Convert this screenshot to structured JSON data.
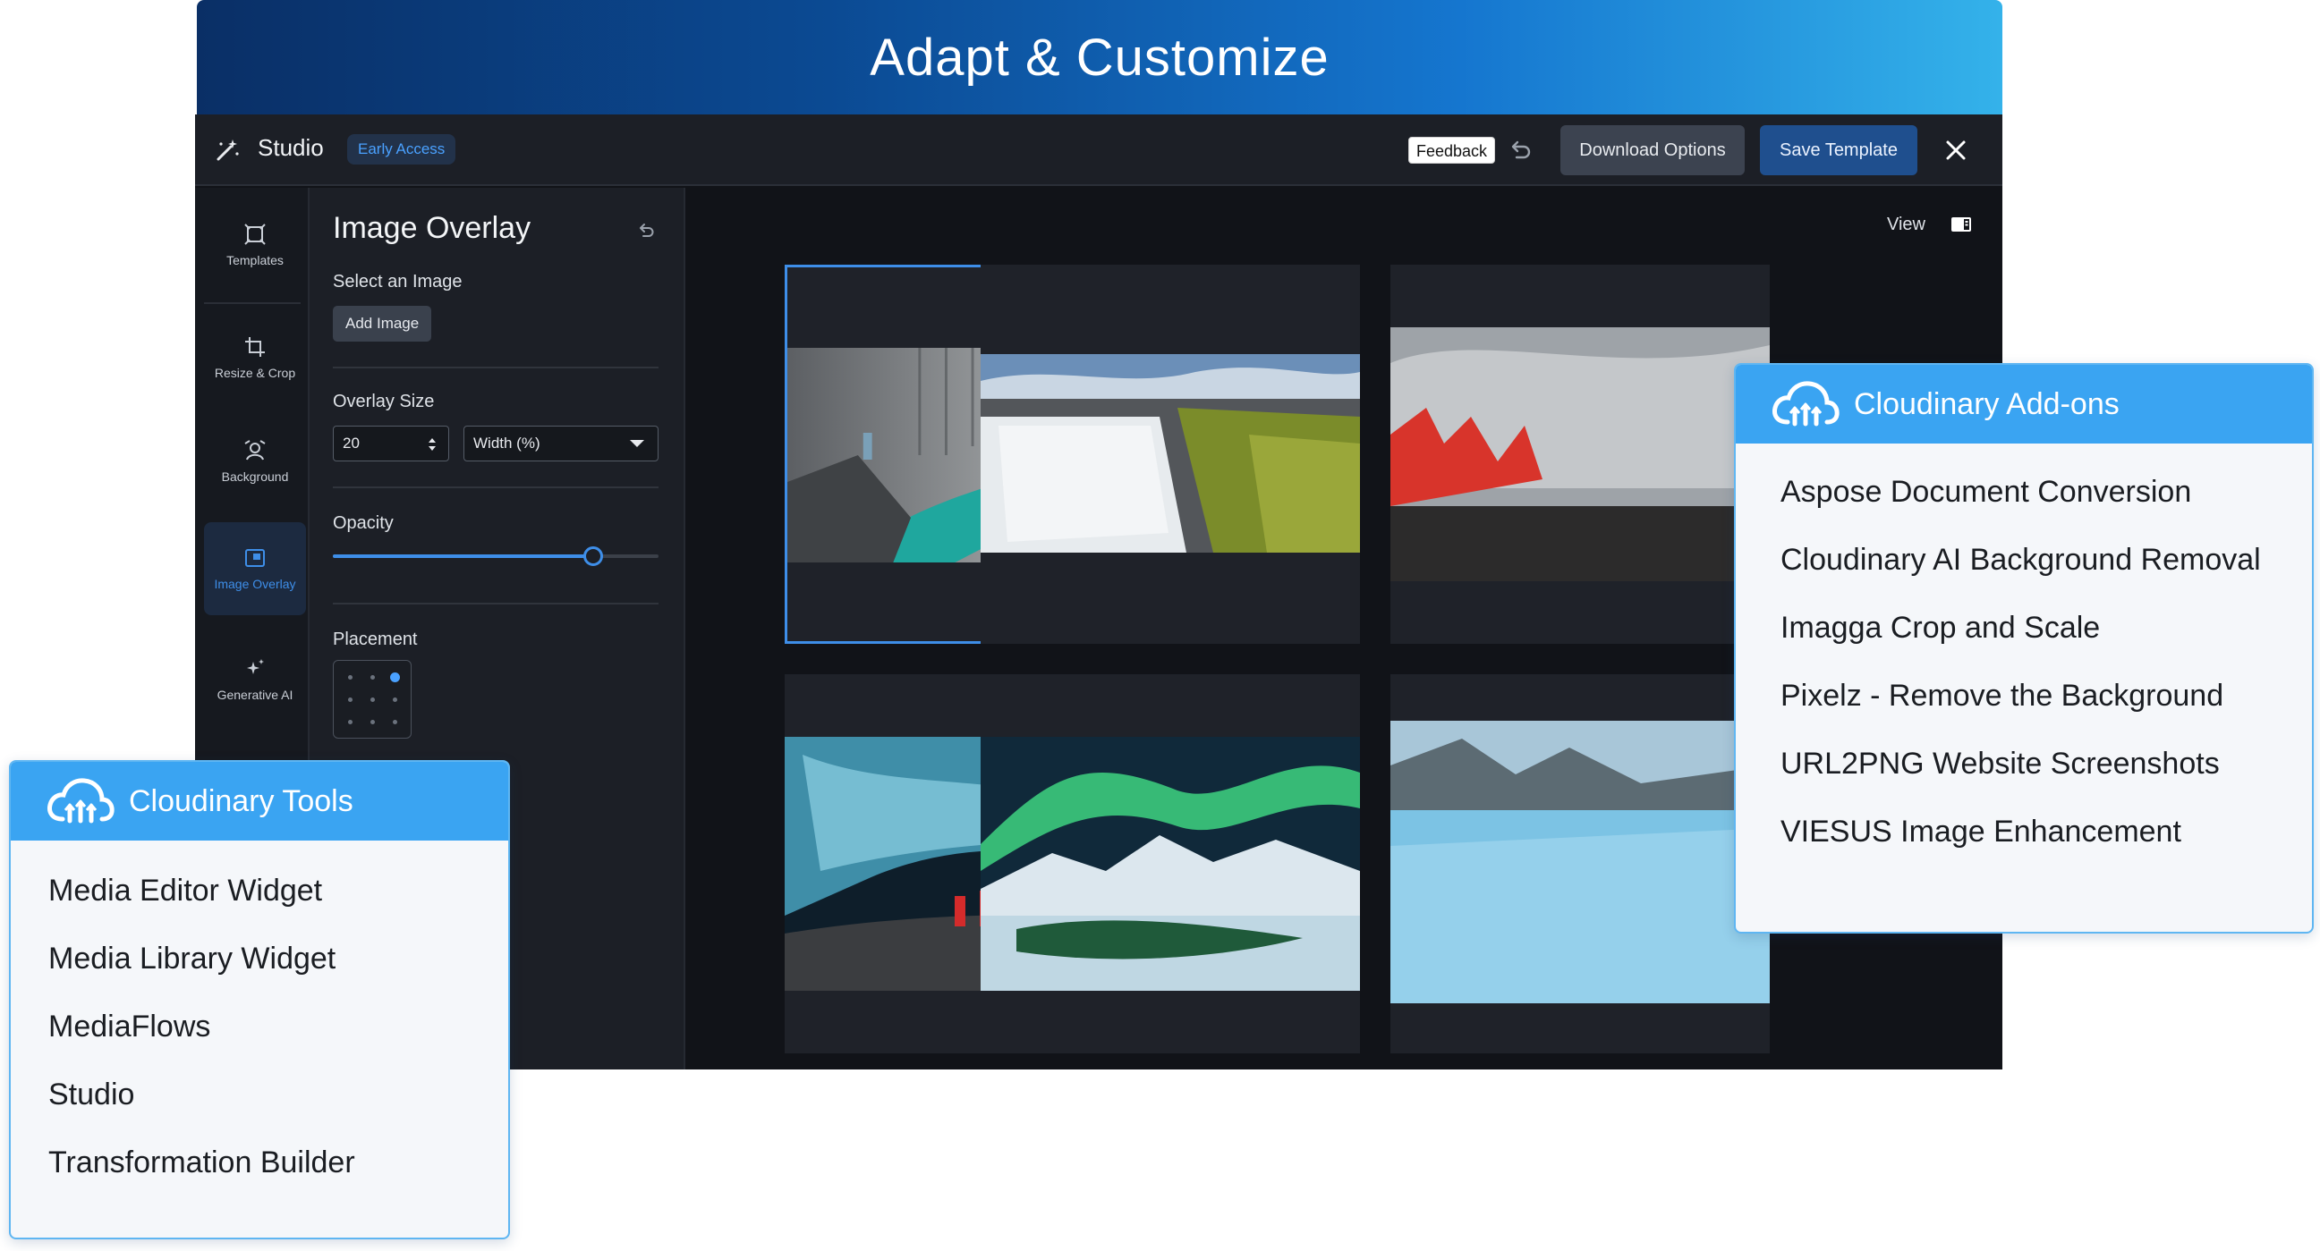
{
  "banner": {
    "title": "Adapt & Customize"
  },
  "topbar": {
    "logo_icon": "magic-wand-icon",
    "title": "Studio",
    "badge": "Early Access",
    "feedback": "Feedback",
    "download_label": "Download Options",
    "save_label": "Save Template",
    "close_icon": "close-icon"
  },
  "rail": {
    "items": [
      {
        "label": "Templates",
        "icon": "templates-icon"
      },
      {
        "label": "Resize & Crop",
        "icon": "crop-icon"
      },
      {
        "label": "Background",
        "icon": "background-icon"
      },
      {
        "label": "Image Overlay",
        "icon": "image-overlay-icon",
        "active": true
      },
      {
        "label": "Generative AI",
        "icon": "sparkle-icon"
      }
    ]
  },
  "panel": {
    "title": "Image Overlay",
    "select_label": "Select an Image",
    "add_image": "Add Image",
    "overlay_size_label": "Overlay Size",
    "overlay_size_value": "20",
    "overlay_unit": "Width (%)",
    "opacity_label": "Opacity",
    "opacity_value": 0.8,
    "placement_label": "Placement",
    "placement_selected": "top-right"
  },
  "canvas": {
    "view_label": "View",
    "images": [
      {
        "name": "basalt-canyon",
        "selected": true
      },
      {
        "name": "waterfall"
      },
      {
        "name": "volcano-eruption"
      },
      {
        "name": "ice-cave"
      },
      {
        "name": "northern-lights"
      },
      {
        "name": "glacier"
      }
    ]
  },
  "tools_card": {
    "title": "Cloudinary Tools",
    "items": [
      "Media Editor Widget",
      "Media Library Widget",
      "MediaFlows",
      "Studio",
      "Transformation Builder"
    ]
  },
  "addons_card": {
    "title": "Cloudinary Add-ons",
    "items": [
      "Aspose Document Conversion",
      "Cloudinary AI Background Removal",
      "Imagga Crop and Scale",
      "Pixelz - Remove the Background",
      "URL2PNG Website Screenshots",
      "VIESUS Image Enhancement"
    ]
  },
  "colors": {
    "accent": "#3e8ee8",
    "card_header": "#3aa4f2",
    "app_bg": "#111318",
    "panel_bg": "#1c1f26"
  }
}
